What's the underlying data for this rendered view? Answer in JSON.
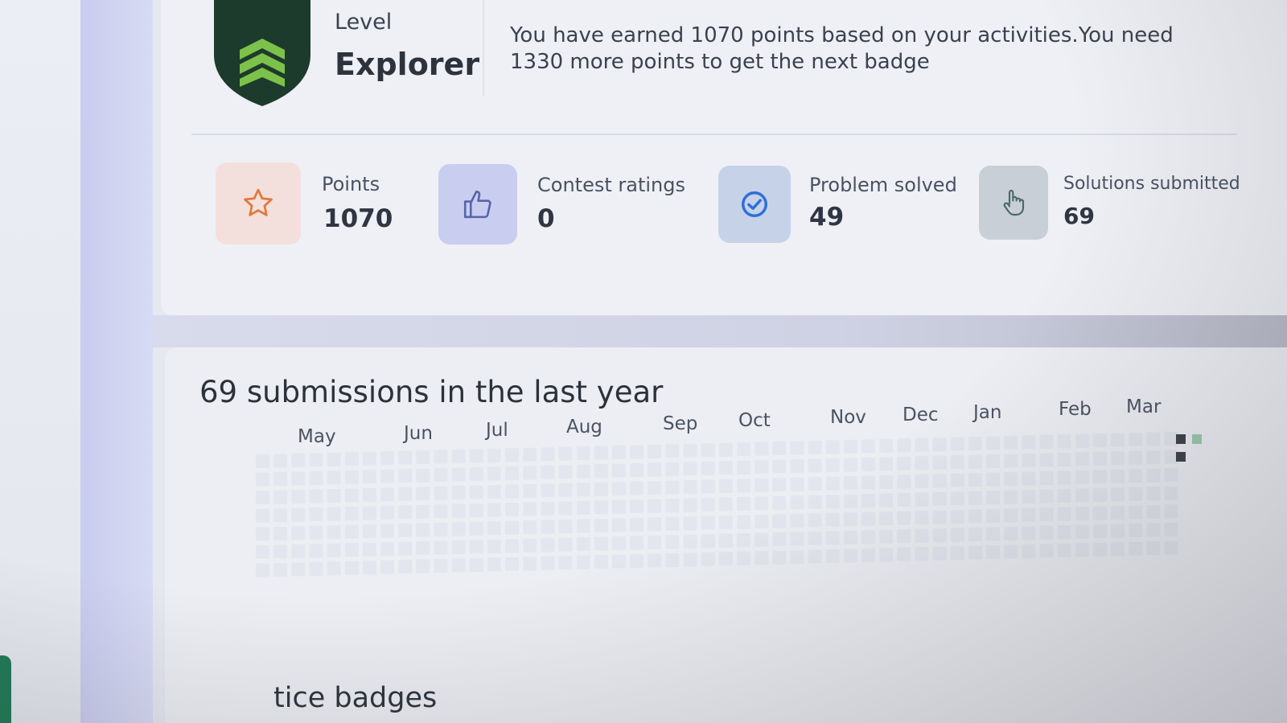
{
  "level": {
    "label": "Level",
    "name": "Explorer",
    "message": "You have earned 1070 points based on your activities.You need 1330 more points to get the next badge",
    "badge_icon": "shield-chevron-icon",
    "badge_colors": {
      "shield": "#1d3b2c",
      "chevrons": "#7cc24a"
    }
  },
  "stats": [
    {
      "label": "Points",
      "value": "1070",
      "icon": "star-icon",
      "tile_color": "#f3e0dc",
      "icon_color": "#e07a3c"
    },
    {
      "label": "Contest ratings",
      "value": "0",
      "icon": "thumbs-up-icon",
      "tile_color": "#c9cdf0",
      "icon_color": "#5a64a8"
    },
    {
      "label": "Problem solved",
      "value": "49",
      "icon": "check-circle-icon",
      "tile_color": "#c6d2e8",
      "icon_color": "#2f6fd8"
    },
    {
      "label": "Solutions submitted",
      "value": "69",
      "icon": "pointer-hand-icon",
      "tile_color": "#c8cfd6",
      "icon_color": "#4b6a6a"
    }
  ],
  "submissions": {
    "title": "69 submissions in the last year",
    "months": [
      "May",
      "Jun",
      "Jul",
      "Aug",
      "Sep",
      "Oct",
      "Nov",
      "Dec",
      "Jan",
      "Feb",
      "Mar"
    ],
    "empty_cell_color": "#dde0ea",
    "active_cell_color": "#3c4148"
  },
  "badges_section": {
    "title_fragment": "tice badges"
  }
}
